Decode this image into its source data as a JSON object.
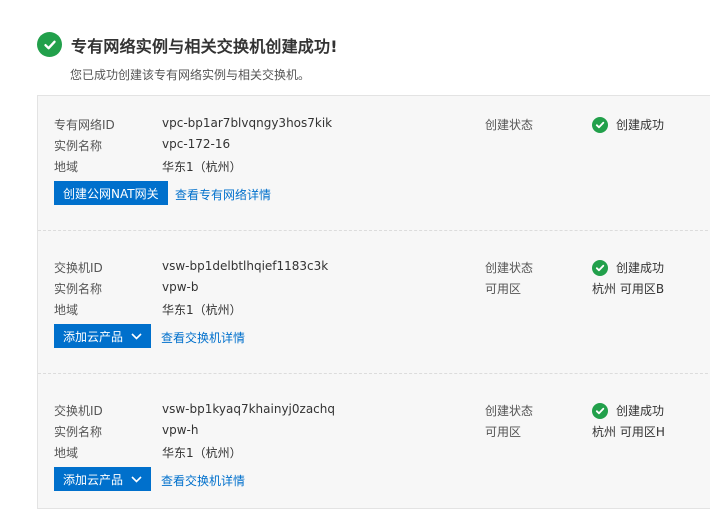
{
  "header": {
    "title": "专有网络实例与相关交换机创建成功!",
    "subtitle": "您已成功创建该专有网络实例与相关交换机。"
  },
  "vpc": {
    "id_label": "专有网络ID",
    "id_value": "vpc-bp1ar7blvqngy3hos7kik",
    "name_label": "实例名称",
    "name_value": "vpc-172-16",
    "region_label": "地域",
    "region_value": "华东1（杭州）",
    "status_label": "创建状态",
    "status_value": "创建成功",
    "button_label": "创建公网NAT网关",
    "link_label": "查看专有网络详情"
  },
  "switches": [
    {
      "id_label": "交换机ID",
      "id_value": "vsw-bp1delbtlhqief1183c3k",
      "name_label": "实例名称",
      "name_value": "vpw-b",
      "region_label": "地域",
      "region_value": "华东1（杭州）",
      "status_label": "创建状态",
      "status_value": "创建成功",
      "zone_label": "可用区",
      "zone_value": "杭州 可用区B",
      "button_label": "添加云产品",
      "link_label": "查看交换机详情"
    },
    {
      "id_label": "交换机ID",
      "id_value": "vsw-bp1kyaq7khainyj0zachq",
      "name_label": "实例名称",
      "name_value": "vpw-h",
      "region_label": "地域",
      "region_value": "华东1（杭州）",
      "status_label": "创建状态",
      "status_value": "创建成功",
      "zone_label": "可用区",
      "zone_value": "杭州 可用区H",
      "button_label": "添加云产品",
      "link_label": "查看交换机详情"
    }
  ],
  "colors": {
    "success": "#22a04b",
    "primary": "#0070cc"
  },
  "icons": {
    "success": "check-circle-icon",
    "dropdown": "chevron-down-icon"
  }
}
